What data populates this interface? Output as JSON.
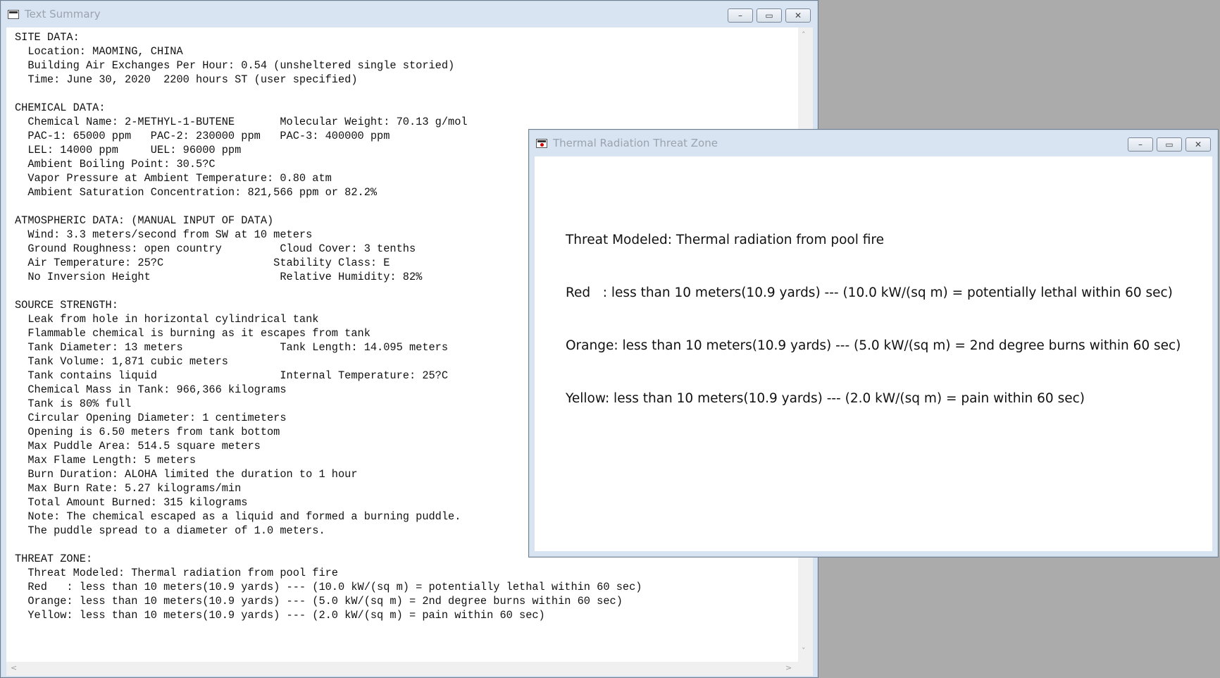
{
  "summary_window": {
    "title": "Text Summary",
    "icon": "text-document-icon",
    "controls": {
      "minimize": "–",
      "maximize": "▭",
      "close": "✕"
    },
    "lines": [
      "SITE DATA:",
      "  Location: MAOMING, CHINA",
      "  Building Air Exchanges Per Hour: 0.54 (unsheltered single storied)",
      "  Time: June 30, 2020  2200 hours ST (user specified)",
      "",
      "CHEMICAL DATA:",
      "  Chemical Name: 2-METHYL-1-BUTENE       Molecular Weight: 70.13 g/mol",
      "  PAC-1: 65000 ppm   PAC-2: 230000 ppm   PAC-3: 400000 ppm",
      "  LEL: 14000 ppm     UEL: 96000 ppm",
      "  Ambient Boiling Point: 30.5?C",
      "  Vapor Pressure at Ambient Temperature: 0.80 atm",
      "  Ambient Saturation Concentration: 821,566 ppm or 82.2%",
      "",
      "ATMOSPHERIC DATA: (MANUAL INPUT OF DATA)",
      "  Wind: 3.3 meters/second from SW at 10 meters",
      "  Ground Roughness: open country         Cloud Cover: 3 tenths",
      "  Air Temperature: 25?C                 Stability Class: E",
      "  No Inversion Height                    Relative Humidity: 82%",
      "",
      "SOURCE STRENGTH:",
      "  Leak from hole in horizontal cylindrical tank",
      "  Flammable chemical is burning as it escapes from tank",
      "  Tank Diameter: 13 meters               Tank Length: 14.095 meters",
      "  Tank Volume: 1,871 cubic meters",
      "  Tank contains liquid                   Internal Temperature: 25?C",
      "  Chemical Mass in Tank: 966,366 kilograms",
      "  Tank is 80% full",
      "  Circular Opening Diameter: 1 centimeters",
      "  Opening is 6.50 meters from tank bottom",
      "  Max Puddle Area: 514.5 square meters",
      "  Max Flame Length: 5 meters",
      "  Burn Duration: ALOHA limited the duration to 1 hour",
      "  Max Burn Rate: 5.27 kilograms/min",
      "  Total Amount Burned: 315 kilograms",
      "  Note: The chemical escaped as a liquid and formed a burning puddle.",
      "  The puddle spread to a diameter of 1.0 meters.",
      "",
      "THREAT ZONE:",
      "  Threat Modeled: Thermal radiation from pool fire",
      "  Red   : less than 10 meters(10.9 yards) --- (10.0 kW/(sq m) = potentially lethal within 60 sec)",
      "  Orange: less than 10 meters(10.9 yards) --- (5.0 kW/(sq m) = 2nd degree burns within 60 sec)",
      "  Yellow: less than 10 meters(10.9 yards) --- (2.0 kW/(sq m) = pain within 60 sec)"
    ],
    "scroll_arrows": {
      "up": "˄",
      "down": "˅",
      "left": "<",
      "right": ">"
    }
  },
  "threat_window": {
    "title": "Thermal Radiation Threat Zone",
    "icon": "threat-zone-icon",
    "controls": {
      "minimize": "–",
      "maximize": "▭",
      "close": "✕"
    },
    "lines": [
      "Threat Modeled: Thermal radiation from pool fire",
      "Red   : less than 10 meters(10.9 yards) --- (10.0 kW/(sq m) = potentially lethal within 60 sec)",
      "Orange: less than 10 meters(10.9 yards) --- (5.0 kW/(sq m) = 2nd degree burns within 60 sec)",
      "Yellow: less than 10 meters(10.9 yards) --- (2.0 kW/(sq m) = pain within 60 sec)"
    ]
  }
}
